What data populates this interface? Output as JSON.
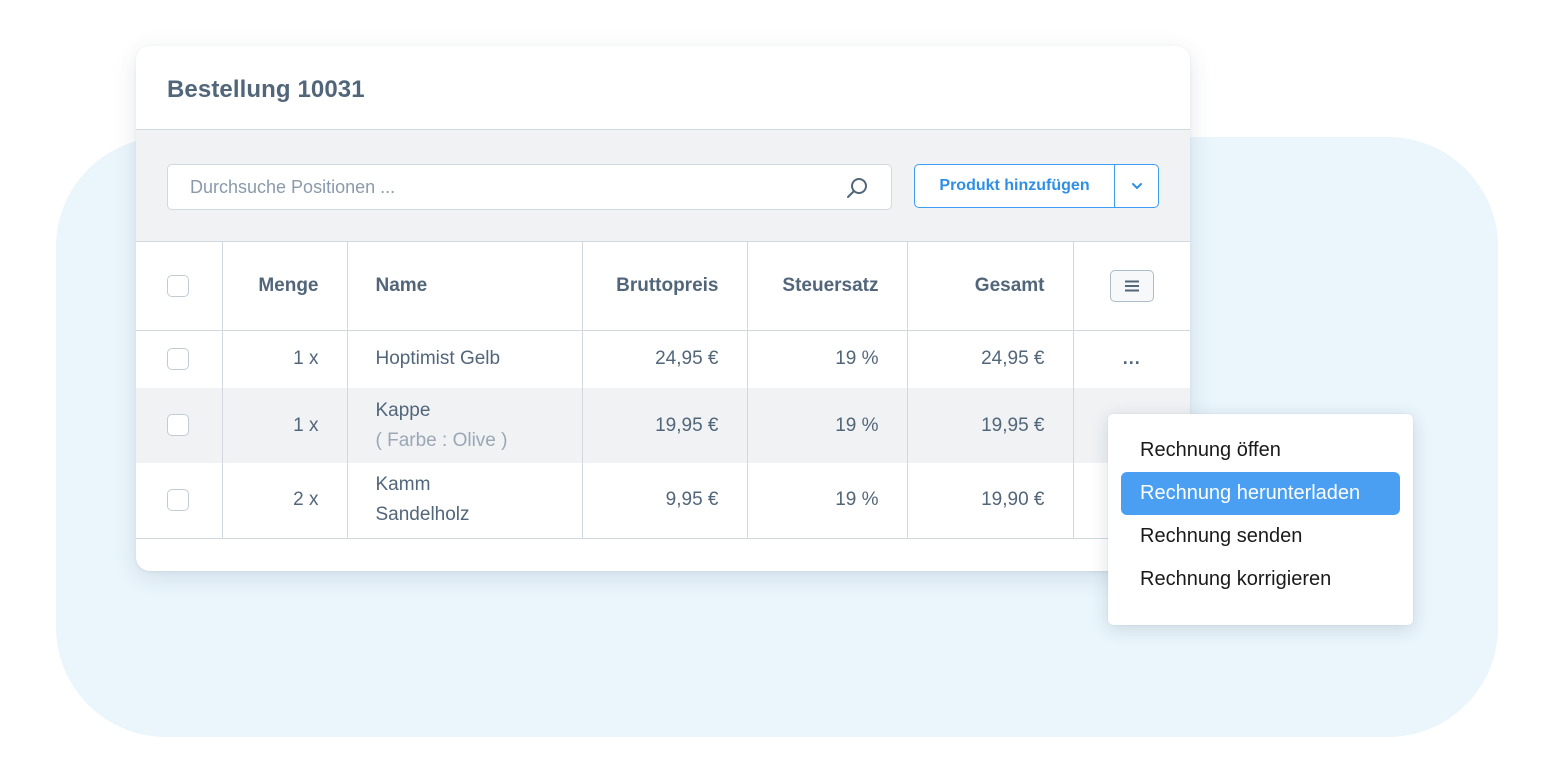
{
  "order": {
    "title": "Bestellung 10031"
  },
  "toolbar": {
    "search_placeholder": "Durchsuche Positionen ...",
    "add_product_label": "Produkt hinzufügen"
  },
  "table": {
    "headers": {
      "menge": "Menge",
      "name": "Name",
      "bruttopreis": "Bruttopreis",
      "steuersatz": "Steuersatz",
      "gesamt": "Gesamt"
    },
    "rows": [
      {
        "menge": "1 x",
        "name": "Hoptimist Gelb",
        "variant": "",
        "bruttopreis": "24,95 €",
        "steuersatz": "19 %",
        "gesamt": "24,95 €",
        "action": "..."
      },
      {
        "menge": "1 x",
        "name": "Kappe",
        "variant": "( Farbe : Olive )",
        "bruttopreis": "19,95 €",
        "steuersatz": "19 %",
        "gesamt": "19,95 €"
      },
      {
        "menge": "2 x",
        "name": "Kamm",
        "variant": "Sandelholz",
        "bruttopreis": "9,95 €",
        "steuersatz": "19 %",
        "gesamt": "19,90 €"
      }
    ]
  },
  "context_menu": {
    "items": [
      {
        "label": "Rechnung öffen"
      },
      {
        "label": "Rechnung herunterladen",
        "active": true
      },
      {
        "label": "Rechnung senden"
      },
      {
        "label": "Rechnung korrigieren"
      }
    ]
  },
  "colors": {
    "accent": "#3d9df2",
    "active_item": "#4a9ff2",
    "background_blob": "#eaf5fc",
    "text": "#52667a"
  }
}
